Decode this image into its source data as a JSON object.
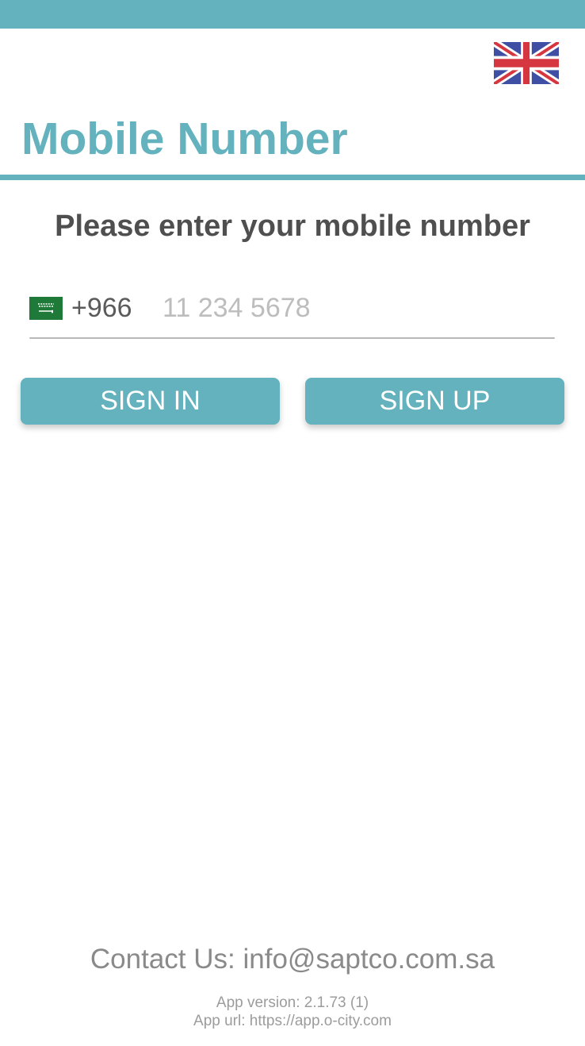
{
  "header": {
    "status_bar_color": "#64b2bd",
    "language_flag_icon": "uk-flag-icon"
  },
  "main": {
    "title": "Mobile Number",
    "instruction": "Please enter your mobile number",
    "phone": {
      "country_flag_icon": "saudi-arabia-flag-icon",
      "dial_code": "+966",
      "value": "",
      "placeholder": "11 234 5678"
    },
    "buttons": {
      "sign_in": "SIGN IN",
      "sign_up": "SIGN UP"
    }
  },
  "footer": {
    "contact_label": "Contact Us:",
    "contact_email": "info@saptco.com.sa",
    "app_version": "App version: 2.1.73 (1)",
    "app_url": "App url: https://app.o-city.com"
  },
  "colors": {
    "accent": "#64b2bd",
    "title_text": "#4f4f4f",
    "muted_text": "#8a8a8a"
  }
}
